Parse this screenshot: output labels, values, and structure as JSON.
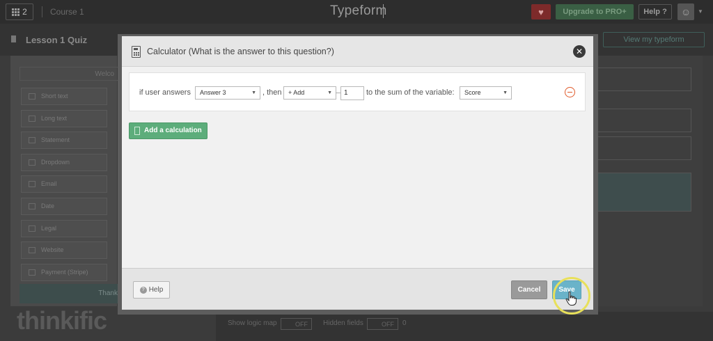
{
  "topbar": {
    "apps_count": "2",
    "breadcrumb": "Course 1",
    "brand": "Typeform",
    "upgrade_label": "Upgrade to PRO+",
    "help_label": "Help ?"
  },
  "page": {
    "title": "Lesson 1 Quiz",
    "view_button": "View my typeform",
    "welcome": "Welco",
    "question_types": [
      "Short text",
      "Long text",
      "Statement",
      "Dropdown",
      "Email",
      "Date",
      "Legal",
      "Website",
      "Payment (Stripe)"
    ],
    "thankyou": "Thank",
    "bottom": {
      "logic_map_label": "Show logic map",
      "logic_map_state": "OFF",
      "hidden_fields_label": "Hidden fields",
      "hidden_fields_state": "OFF",
      "hidden_fields_count": "0"
    },
    "watermark": "thinkific"
  },
  "modal": {
    "title": "Calculator (What is the answer to this question?)",
    "rule": {
      "prefix": "if user answers",
      "answer": "Answer 3",
      "then": ", then",
      "operation": "+ Add",
      "amount": "1",
      "suffix": "to the sum of the variable:",
      "variable": "Score"
    },
    "add_calculation": "Add a calculation",
    "help": "Help",
    "cancel": "Cancel",
    "save": "Save"
  },
  "colors": {
    "accent_green": "#5dad7b",
    "save_blue": "#6ab3c9",
    "remove_orange": "#e05a2a",
    "click_highlight": "#e8e05a"
  }
}
